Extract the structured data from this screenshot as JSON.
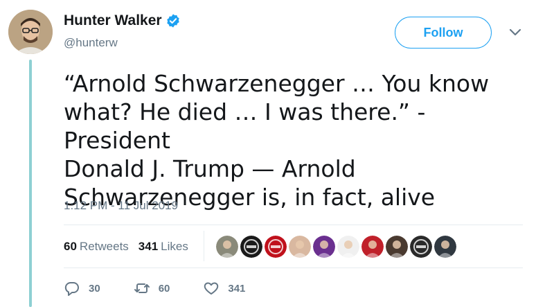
{
  "author": {
    "display_name": "Hunter Walker",
    "handle": "@hunterw",
    "verified": true
  },
  "follow_button": {
    "label": "Follow"
  },
  "tweet": {
    "text": "“Arnold Schwarzenegger … You know\nwhat? He died … I was there.” - President\nDonald J. Trump — Arnold\nSchwarzenegger is, in fact, alive",
    "timestamp": "1:12 PM - 11 Jul 2019"
  },
  "stats": {
    "retweets_count": "60",
    "retweets_label": "Retweets",
    "likes_count": "341",
    "likes_label": "Likes"
  },
  "likers": [
    {
      "icon": "person-avatar",
      "color": "#8a8a7a"
    },
    {
      "icon": "logo-avatar",
      "color": "#1a1a1a"
    },
    {
      "icon": "logo-avatar",
      "color": "#c0111c"
    },
    {
      "icon": "person-avatar",
      "color": "#d9b8a0"
    },
    {
      "icon": "person-avatar",
      "color": "#6a2f8f"
    },
    {
      "icon": "person-avatar",
      "color": "#f0f0f0"
    },
    {
      "icon": "person-avatar",
      "color": "#c0202a"
    },
    {
      "icon": "person-avatar",
      "color": "#4a3a30"
    },
    {
      "icon": "logo-avatar",
      "color": "#2a2a2a"
    },
    {
      "icon": "person-avatar",
      "color": "#303840"
    }
  ],
  "actions": {
    "reply_count": "30",
    "retweet_count": "60",
    "like_count": "341"
  },
  "colors": {
    "accent": "#1da1f2",
    "thread_line": "#8ed0d3",
    "muted_text": "#657786"
  }
}
